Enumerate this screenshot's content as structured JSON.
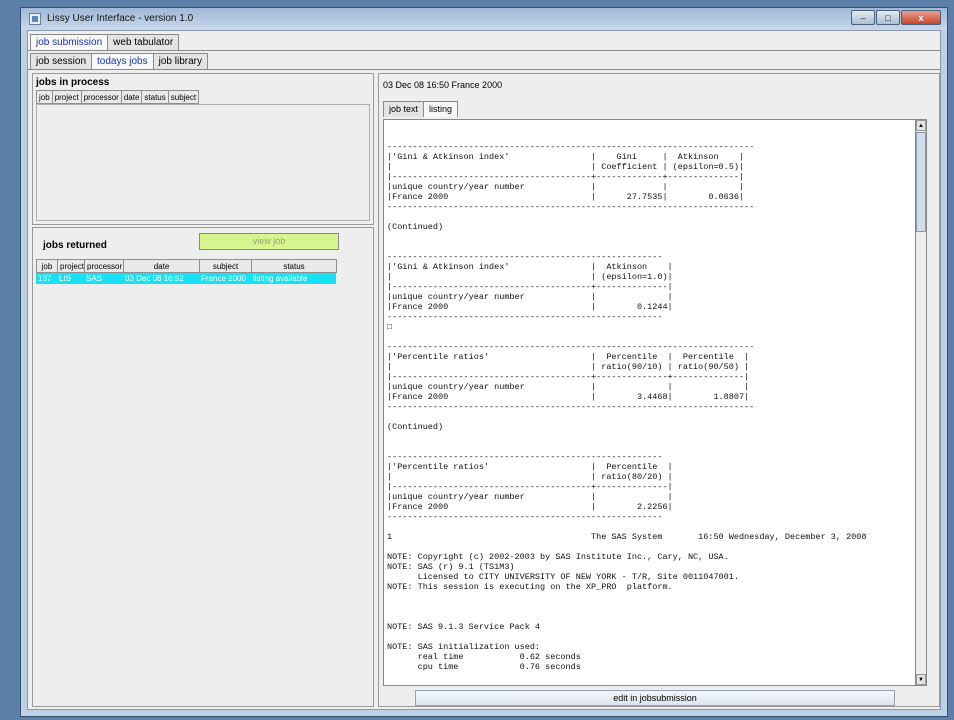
{
  "window": {
    "title": "Lissy User Interface - version 1.0",
    "controls": {
      "minimize": "–",
      "maximize": "□",
      "close": "x"
    }
  },
  "top_tabs": [
    "job submission",
    "web tabulator"
  ],
  "sub_tabs": [
    "job session",
    "todays jobs",
    "job library"
  ],
  "jobs_in_process": {
    "title": "jobs in process",
    "columns": [
      "job",
      "project",
      "processor",
      "date",
      "status",
      "subject"
    ]
  },
  "jobs_returned": {
    "title": "jobs returned",
    "view_job_label": "view job",
    "columns": [
      "job",
      "project",
      "processor",
      "date",
      "subject",
      "status"
    ],
    "rows": [
      {
        "job": "137",
        "project": "LIS",
        "processor": "SAS",
        "date": "03 Dec 08 16:52",
        "subject": "France 2000",
        "status": "listing available"
      }
    ]
  },
  "output": {
    "header": "03 Dec 08 16:50 France 2000",
    "tabs": [
      "job text",
      "listing"
    ],
    "edit_button": "edit in jobsubmission",
    "listing_lines": [
      "------------------------------------------------------------------------",
      "|'Gini & Atkinson index'                |    Gini     |  Atkinson    |",
      "|                                       | Coefficient | (epsilon=0.5)|",
      "|---------------------------------------+-------------+--------------|",
      "|unique country/year number             |             |              |",
      "|France 2000                            |      27.7535|        0.0636|",
      "------------------------------------------------------------------------",
      "",
      "(Continued)",
      "",
      "",
      "------------------------------------------------------",
      "|'Gini & Atkinson index'                |  Atkinson    |",
      "|                                       | (epsilon=1.0)|",
      "|---------------------------------------+--------------|",
      "|unique country/year number             |              |",
      "|France 2000                            |        0.1244|",
      "------------------------------------------------------",
      "□",
      "",
      "------------------------------------------------------------------------",
      "|'Percentile ratios'                    |  Percentile  |  Percentile  |",
      "|                                       | ratio(90/10) | ratio(90/50) |",
      "|---------------------------------------+--------------+--------------|",
      "|unique country/year number             |              |              |",
      "|France 2000                            |        3.4468|        1.8807|",
      "------------------------------------------------------------------------",
      "",
      "(Continued)",
      "",
      "",
      "------------------------------------------------------",
      "|'Percentile ratios'                    |  Percentile  |",
      "|                                       | ratio(80/20) |",
      "|---------------------------------------+--------------|",
      "|unique country/year number             |              |",
      "|France 2000                            |        2.2256|",
      "------------------------------------------------------",
      "",
      "1                                       The SAS System       16:50 Wednesday, December 3, 2008",
      "",
      "NOTE: Copyright (c) 2002-2003 by SAS Institute Inc., Cary, NC, USA.",
      "NOTE: SAS (r) 9.1 (TS1M3)",
      "      Licensed to CITY UNIVERSITY OF NEW YORK - T/R, Site 0011047001.",
      "NOTE: This session is executing on the XP_PRO  platform.",
      "",
      "",
      "",
      "NOTE: SAS 9.1.3 Service Pack 4",
      "",
      "NOTE: SAS initialization used:",
      "      real time           0.62 seconds",
      "      cpu time            0.76 seconds"
    ]
  },
  "colors": {
    "selected_row": "#19e1f5",
    "view_job_button": "#d7f58f",
    "active_tab_text": "#1a35b8"
  }
}
